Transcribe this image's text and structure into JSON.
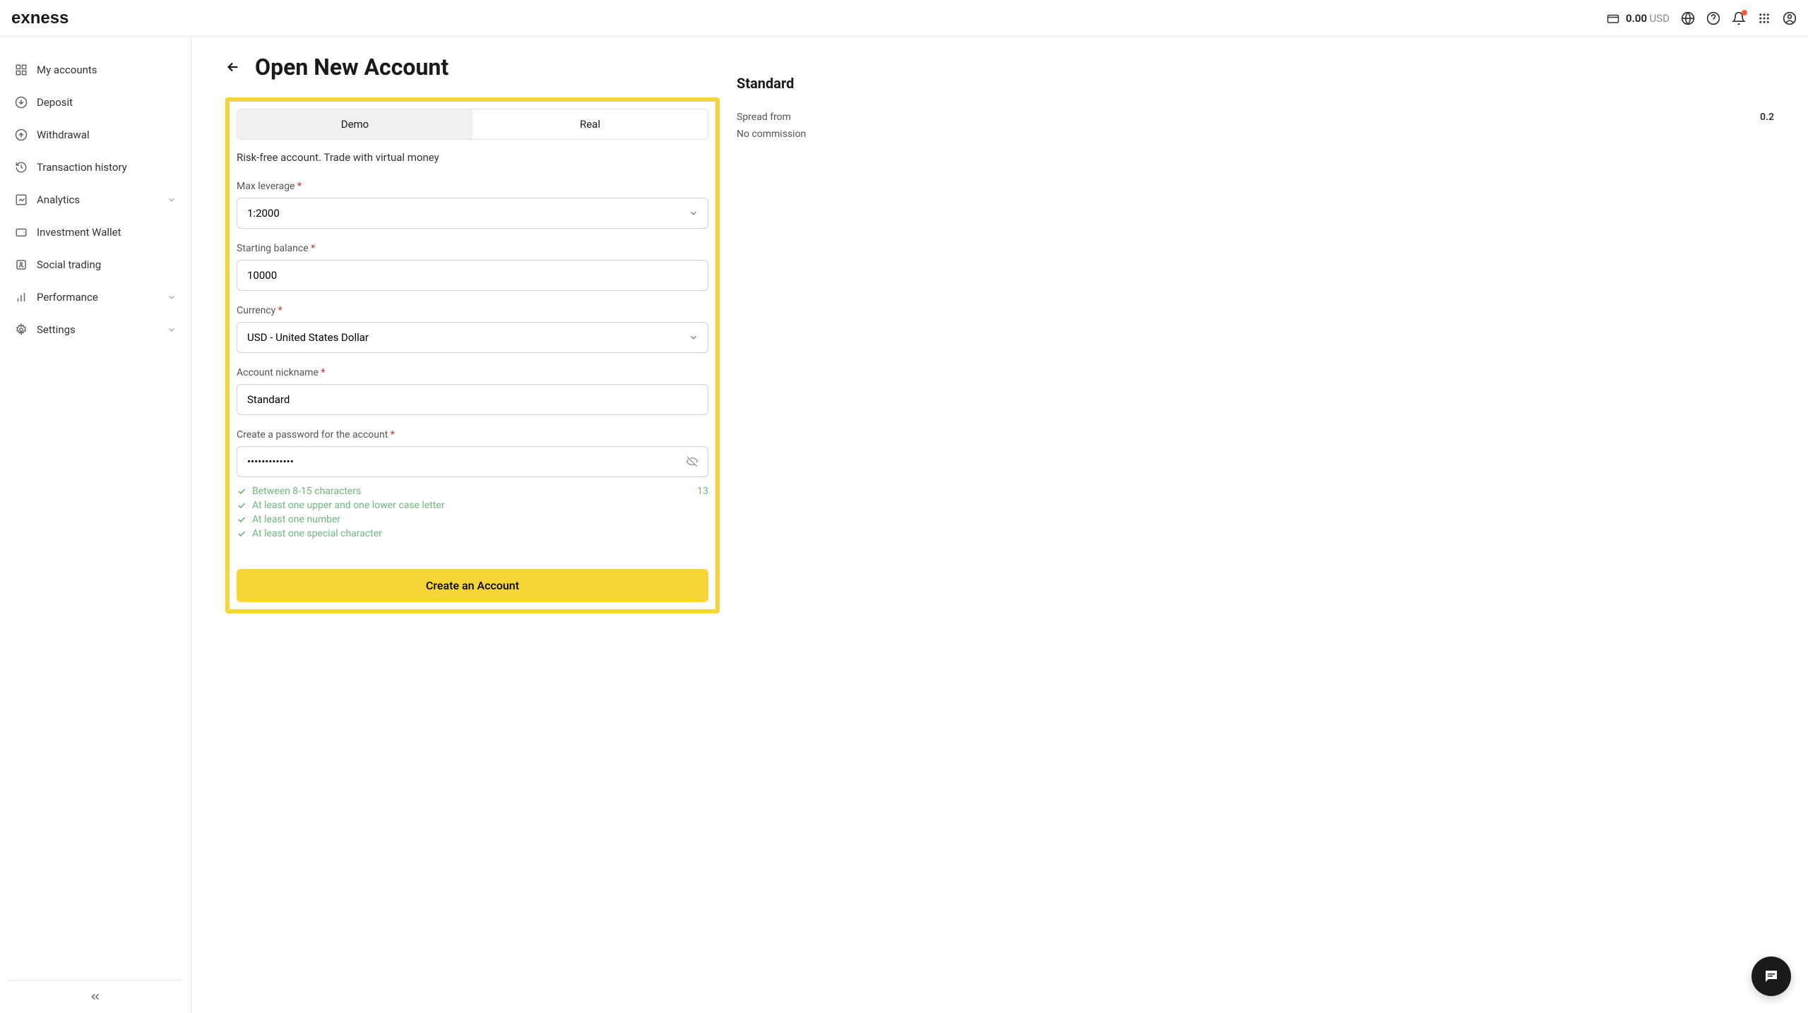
{
  "header": {
    "balance_amount": "0.00",
    "balance_currency": "USD"
  },
  "sidebar": {
    "items": [
      {
        "label": "My accounts"
      },
      {
        "label": "Deposit"
      },
      {
        "label": "Withdrawal"
      },
      {
        "label": "Transaction history"
      },
      {
        "label": "Analytics"
      },
      {
        "label": "Investment Wallet"
      },
      {
        "label": "Social trading"
      },
      {
        "label": "Performance"
      },
      {
        "label": "Settings"
      }
    ]
  },
  "page": {
    "title": "Open New Account"
  },
  "form": {
    "tabs": {
      "demo": "Demo",
      "real": "Real"
    },
    "description": "Risk-free account. Trade with virtual money",
    "max_leverage": {
      "label": "Max leverage",
      "value": "1:2000"
    },
    "starting_balance": {
      "label": "Starting balance",
      "value": "10000"
    },
    "currency": {
      "label": "Currency",
      "value": "USD - United States Dollar"
    },
    "nickname": {
      "label": "Account nickname",
      "value": "Standard"
    },
    "password": {
      "label": "Create a password for the account",
      "value": "•••••••••••••",
      "char_count": "13",
      "rules": {
        "r1": "Between 8-15 characters",
        "r2": "At least one upper and one lower case letter",
        "r3": "At least one number",
        "r4": "At least one special character"
      }
    },
    "submit": "Create an Account"
  },
  "info": {
    "title": "Standard",
    "spread_label": "Spread from",
    "spread_value": "0.2",
    "commission_label": "No commission"
  }
}
